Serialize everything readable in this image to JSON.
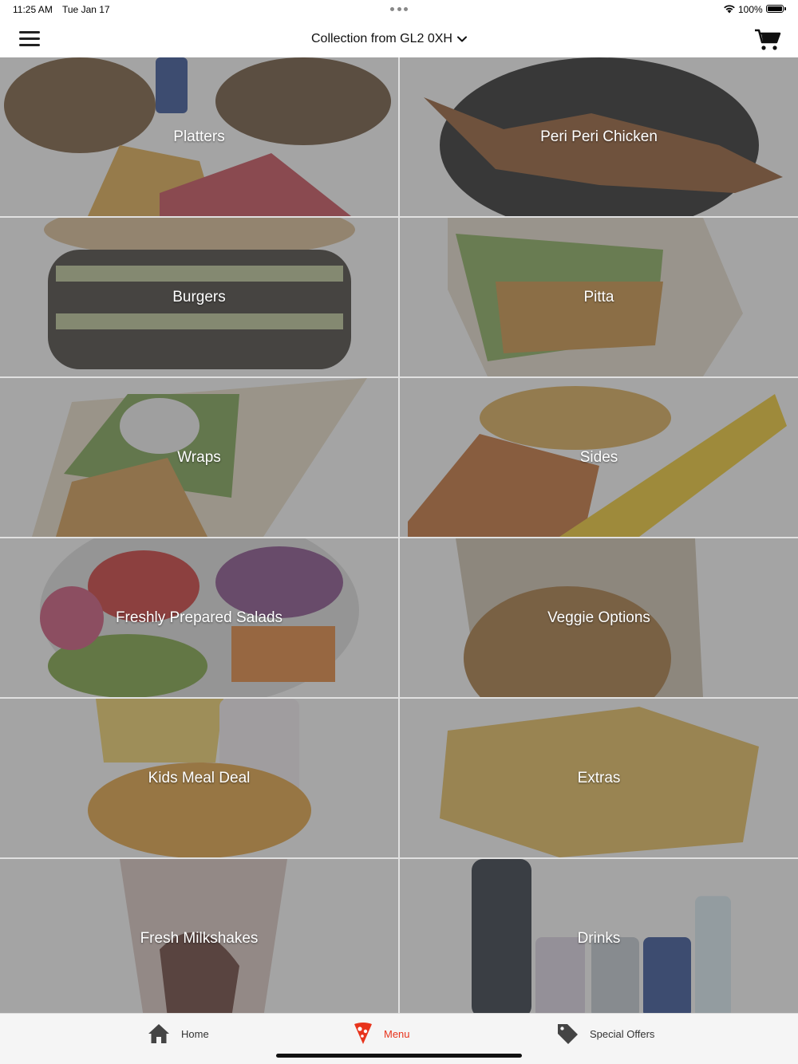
{
  "status": {
    "time": "11:25 AM",
    "date": "Tue Jan 17",
    "battery": "100%"
  },
  "header": {
    "collection": "Collection from GL2 0XH"
  },
  "categories": [
    {
      "label": "Platters"
    },
    {
      "label": "Peri Peri Chicken"
    },
    {
      "label": "Burgers"
    },
    {
      "label": "Pitta"
    },
    {
      "label": "Wraps"
    },
    {
      "label": "Sides"
    },
    {
      "label": "Freshly Prepared Salads"
    },
    {
      "label": "Veggie Options"
    },
    {
      "label": "Kids Meal Deal"
    },
    {
      "label": "Extras"
    },
    {
      "label": "Fresh Milkshakes"
    },
    {
      "label": "Drinks"
    }
  ],
  "tabs": [
    {
      "label": "Home",
      "icon": "home-icon"
    },
    {
      "label": "Menu",
      "icon": "pizza-icon"
    },
    {
      "label": "Special Offers",
      "icon": "tag-icon"
    }
  ],
  "colors": {
    "accent": "#e8341c",
    "overlay": "#5a5a5a"
  }
}
